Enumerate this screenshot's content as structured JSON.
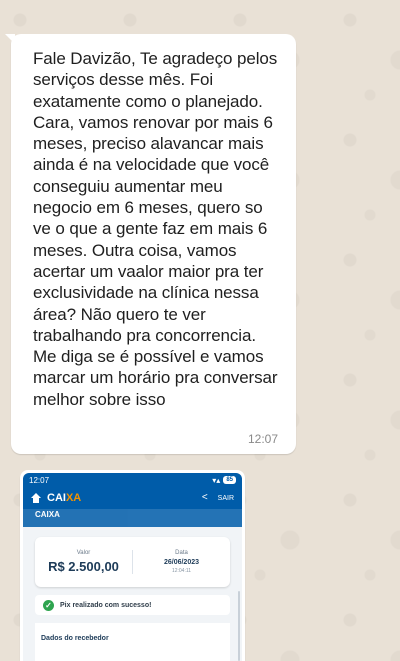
{
  "message": {
    "text": "Fale Davizão, Te agradeço pelos serviços desse mês. Foi exatamente como o planejado. Cara, vamos renovar por mais 6 meses, preciso alavancar mais ainda é na velocidade que você conseguiu aumentar meu negocio em 6 meses, quero so ve o que a gente faz em mais 6 meses. Outra coisa, vamos acertar um vaalor maior pra ter exclusividade na clínica nessa área? Não quero te ver trabalhando pra concorrencia. Me diga se é possível e vamos marcar um horário pra conversar melhor sobre isso",
    "time": "12:07"
  },
  "receipt": {
    "status_time": "12:07",
    "battery": "85",
    "brand_main": "CAI",
    "brand_x": "XA",
    "share_label": "SAIR",
    "sub_header": "CAIXA",
    "amount_label": "Valor",
    "amount": "R$ 2.500,00",
    "date_label": "Data",
    "date": "26/06/2023",
    "time": "12:04:11",
    "success_text": "Pix realizado com sucesso!",
    "receiver_title": "Dados do recebedor"
  },
  "colors": {
    "brand_blue": "#005ca9",
    "brand_orange": "#f39200",
    "success_green": "#2ea44f"
  },
  "icons": [
    "home-icon",
    "share-icon",
    "check-icon",
    "signal-icon"
  ]
}
